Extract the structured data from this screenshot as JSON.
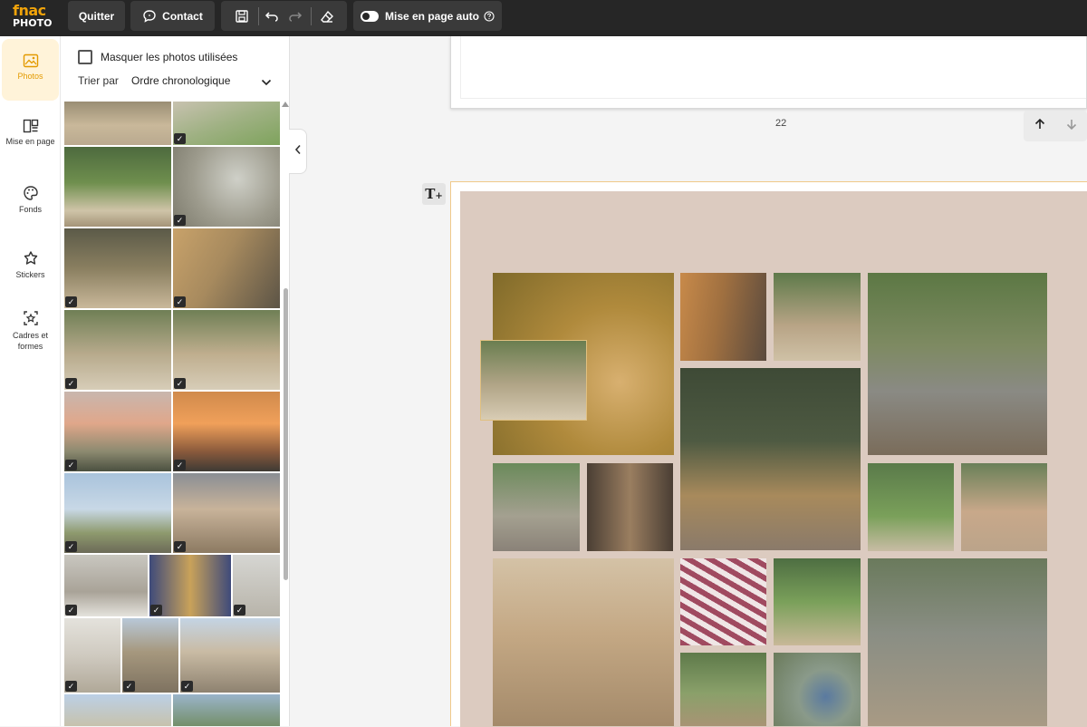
{
  "app": {
    "logo_top": "fnac",
    "logo_bottom": "PHOTO"
  },
  "toolbar": {
    "quit_label": "Quitter",
    "contact_label": "Contact",
    "auto_layout_label": "Mise en page auto"
  },
  "rail": {
    "items": [
      {
        "label": "Photos",
        "icon": "photo-icon",
        "active": true
      },
      {
        "label": "Mise en page",
        "icon": "layout-icon"
      },
      {
        "label": "Fonds",
        "icon": "palette-icon"
      },
      {
        "label": "Stickers",
        "icon": "sticker-icon"
      },
      {
        "label": "Cadres et formes",
        "icon": "frame-icon"
      }
    ]
  },
  "panel": {
    "hide_used_label": "Masquer les photos utilisées",
    "hide_used_checked": false,
    "sort_label": "Trier par",
    "sort_value": "Ordre chronologique"
  },
  "canvas": {
    "prev_page_number": "22",
    "accent_color": "#f0c98a",
    "page_background": "#dccbc0"
  }
}
